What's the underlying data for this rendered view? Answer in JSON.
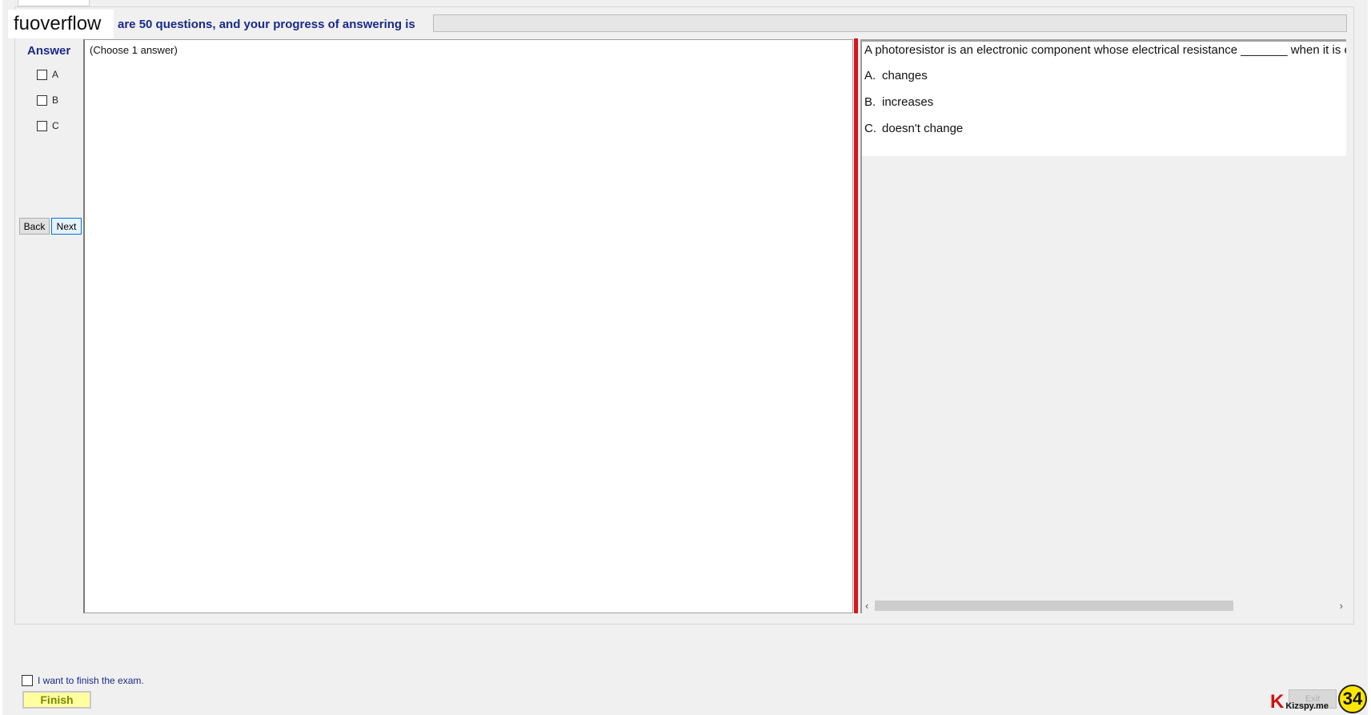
{
  "header": {
    "watermark": "fuoverflow",
    "progress_text": "are 50 questions, and your progress of answering is",
    "progress_value": 0
  },
  "answer_panel": {
    "title": "Answer",
    "options": [
      "A",
      "B",
      "C"
    ],
    "back_label": "Back",
    "next_label": "Next"
  },
  "left_pane": {
    "instruction": "(Choose 1 answer)"
  },
  "question": {
    "text": "A photoresistor is an electronic component whose electrical resistance _______ when it is ex",
    "options": [
      {
        "letter": "A.",
        "text": "changes"
      },
      {
        "letter": "B.",
        "text": "increases"
      },
      {
        "letter": "C.",
        "text": "doesn't change"
      }
    ]
  },
  "footer": {
    "finish_check_label": "I want to finish the exam.",
    "finish_label": "Finish",
    "exit_label": "Exit",
    "brand_letter": "K",
    "brand_text": "Kizspy.me",
    "counter": "34"
  },
  "colors": {
    "splitter": "#d8141c",
    "heading_blue": "#1a2a8a",
    "finish_bg": "#ffffa0",
    "counter_bg": "#ffe600"
  },
  "icons": {
    "scroll_left": "chevron-left-icon",
    "scroll_right": "chevron-right-icon"
  }
}
